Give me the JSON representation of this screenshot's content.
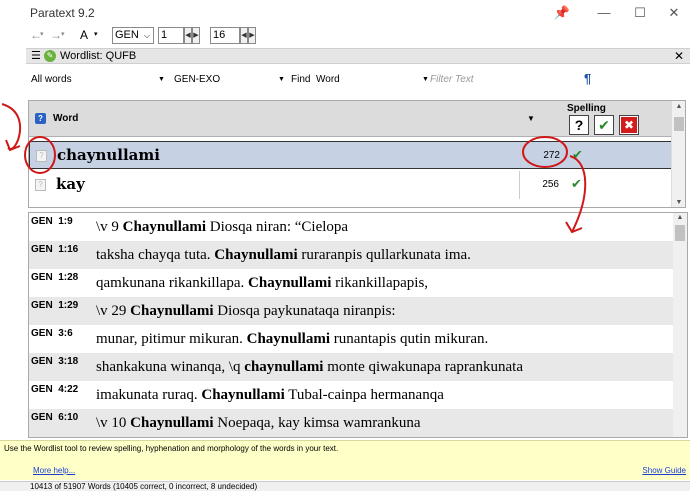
{
  "window": {
    "title": "Paratext 9.2",
    "pin_icon": "pin-icon",
    "minimize_icon": "minimize-icon",
    "maximize_icon": "maximize-icon",
    "close_icon": "close-icon"
  },
  "toolbar": {
    "back_icon": "back-arrow-icon",
    "forward_icon": "forward-arrow-icon",
    "text_style": "A",
    "book": "GEN",
    "chapter": "1",
    "verse": "16"
  },
  "panel": {
    "title": "Wordlist: QUFB",
    "close_glyph": "✕"
  },
  "filters": {
    "scope": "All words",
    "range": "GEN-EXO",
    "find_label": "Find",
    "find_mode": "Word",
    "filter_placeholder": "Filter Text",
    "pilcrow": "¶"
  },
  "grid": {
    "header_word": "Word",
    "header_spelling": "Spelling",
    "spelling_buttons": {
      "unknown": "?",
      "correct": "✔",
      "incorrect": "✖"
    },
    "rows": [
      {
        "word": "chaynullami",
        "count": "272",
        "status": "✔",
        "selected": true
      },
      {
        "word": "kay",
        "count": "256",
        "status": "✔",
        "selected": false
      }
    ]
  },
  "references": [
    {
      "ref": "GEN  1:9",
      "pre": "\\v 9 ",
      "word": "Chaynullami",
      "post": " Diosqa niran: “Cielopa"
    },
    {
      "ref": "GEN  1:16",
      "pre": "taksha chayqa tuta. ",
      "word": "Chaynullami",
      "post": " ruraranpis qullarkunata ima."
    },
    {
      "ref": "GEN  1:28",
      "pre": "qamkunana rikankillapa. ",
      "word": "Chaynullami",
      "post": " rikankillapapis,"
    },
    {
      "ref": "GEN  1:29",
      "pre": "\\v 29 ",
      "word": "Chaynullami",
      "post": " Diosqa paykunataqa niranpis:"
    },
    {
      "ref": "GEN  3:6",
      "pre": "munar, pitimur mikuran. ",
      "word": "Chaynullami",
      "post": " runantapis qutin mikuran."
    },
    {
      "ref": "GEN  3:18",
      "pre": "shankakuna winanqa, \\q ",
      "word": "chaynullami",
      "post": " monte qiwakunapa raprankunata"
    },
    {
      "ref": "GEN  4:22",
      "pre": "imakunata ruraq. ",
      "word": "Chaynullami",
      "post": " Tubal-cainpa hermananqa"
    },
    {
      "ref": "GEN  6:10",
      "pre": "\\v 10 ",
      "word": "Chaynullami",
      "post": " Noepaqa, kay kimsa wamrankuna"
    }
  ],
  "guide": {
    "text": "Use the Wordlist tool to review spelling, hyphenation and morphology of the words in your text.",
    "more_help": "More help...",
    "show_guide": "Show Guide"
  },
  "status": {
    "text": "10413 of 51907 Words (10405 correct, 0 incorrect, 8 undecided)"
  },
  "colors": {
    "selected_row": "#c6d2e4",
    "guide_bg": "#ffffc8",
    "annotation": "#d01818",
    "check": "#2a8a2a"
  }
}
